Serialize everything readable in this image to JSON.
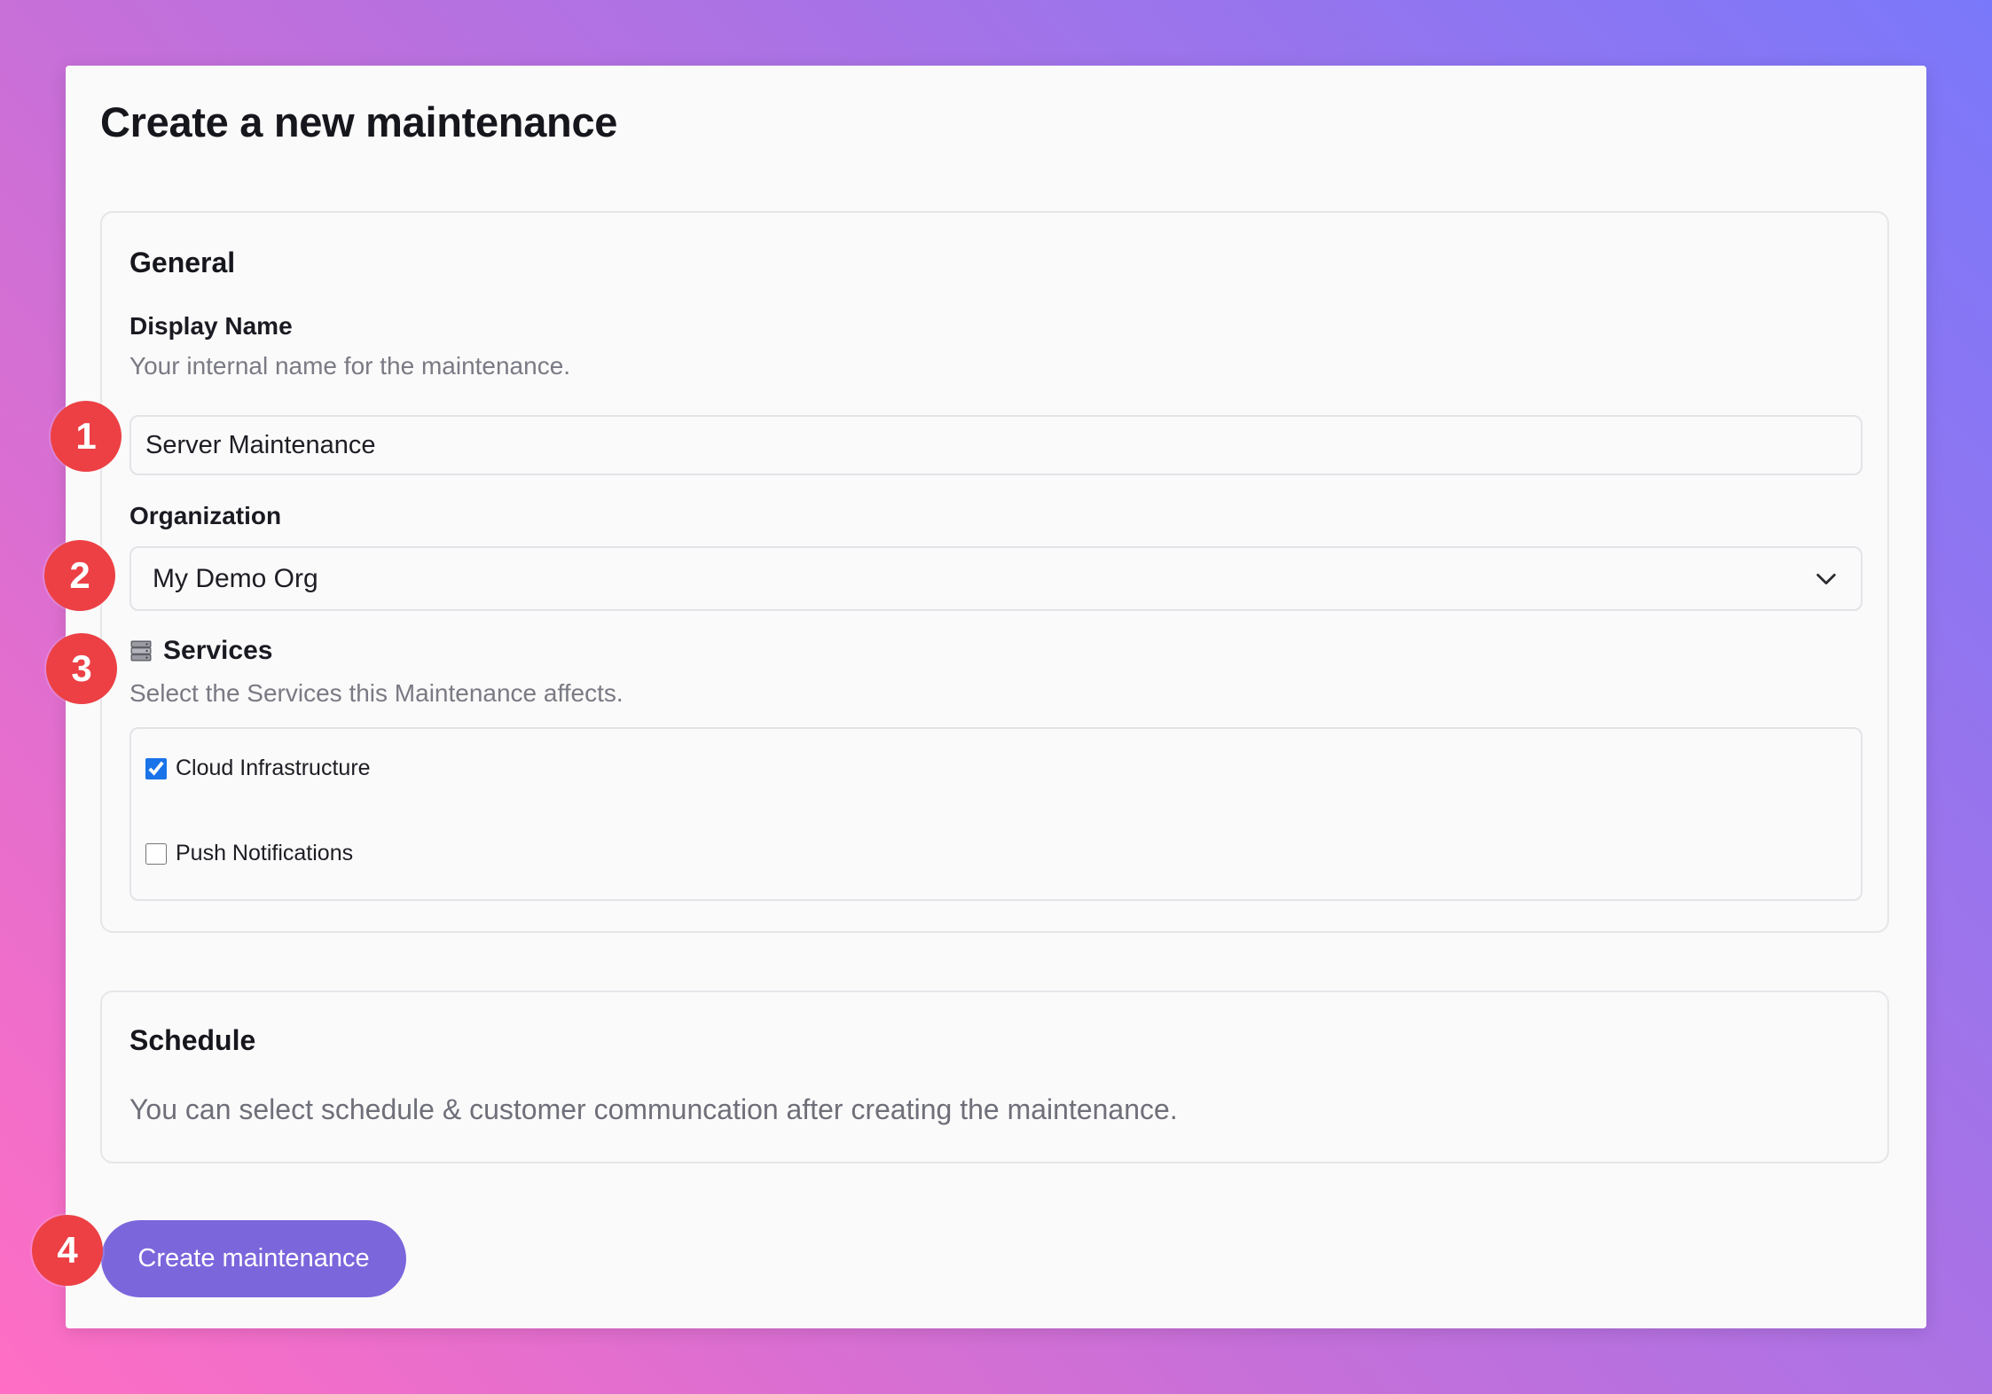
{
  "page": {
    "title": "Create a new maintenance"
  },
  "general": {
    "title": "General",
    "display_name": {
      "label": "Display Name",
      "help": "Your internal name for the maintenance.",
      "value": "Server Maintenance"
    },
    "organization": {
      "label": "Organization",
      "selected": "My Demo Org"
    },
    "services": {
      "label": "Services",
      "help": "Select the Services this Maintenance affects.",
      "items": [
        {
          "label": "Cloud Infrastructure",
          "checked": true
        },
        {
          "label": "Push Notifications",
          "checked": false
        }
      ]
    }
  },
  "schedule": {
    "title": "Schedule",
    "text": "You can select schedule & customer communcation after creating the maintenance."
  },
  "actions": {
    "create_label": "Create maintenance"
  },
  "annotations": [
    "1",
    "2",
    "3",
    "4"
  ],
  "icons": {
    "services": "server-icon",
    "select": "chevron-down-icon"
  },
  "colors": {
    "primary_button": "#7c66dc",
    "badge": "#ec4045",
    "checkbox": "#1a73e8"
  }
}
